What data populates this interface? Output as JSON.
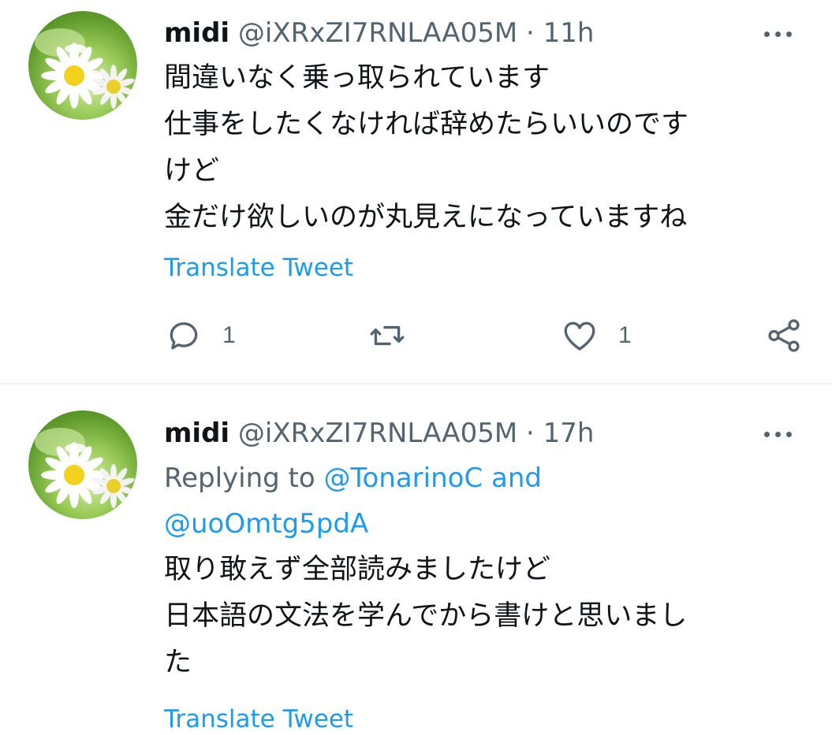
{
  "tweets": [
    {
      "name": "midi",
      "handle": "@iXRxZI7RNLAA05M",
      "dot": "·",
      "time": "11h",
      "lines": [
        "間違いなく乗っ取られています",
        "仕事をしたくなければ辞めたらいいのです",
        "けど",
        "金だけ欲しいのが丸見えになっていますね"
      ],
      "translate": "Translate Tweet",
      "reply_count": "1",
      "like_count": "1"
    },
    {
      "name": "midi",
      "handle": "@iXRxZI7RNLAA05M",
      "dot": "·",
      "time": "17h",
      "replying_prefix": "Replying to",
      "mention_1": "@TonarinoC",
      "mention_and": "and",
      "mention_2": "@uoOmtg5pdA",
      "lines": [
        "取り敢えず全部読みましたけど",
        "日本語の文法を学んでから書けと思いまし",
        "た"
      ],
      "translate": "Translate Tweet"
    }
  ],
  "colors": {
    "text": "#0f1419",
    "secondary": "#536471",
    "link": "#1d9bf0",
    "divider": "#eff3f4"
  },
  "icons": {
    "more": "more-horizontal-icon",
    "reply": "reply-bubble-icon",
    "retweet": "retweet-icon",
    "like": "heart-icon",
    "share": "share-icon"
  }
}
